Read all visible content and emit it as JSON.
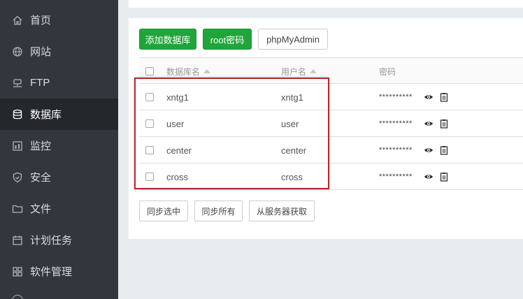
{
  "sidebar": {
    "items": [
      {
        "label": "首页",
        "icon": "home-icon"
      },
      {
        "label": "网站",
        "icon": "globe-icon"
      },
      {
        "label": "FTP",
        "icon": "ftp-icon"
      },
      {
        "label": "数据库",
        "icon": "database-icon",
        "active": true
      },
      {
        "label": "监控",
        "icon": "monitor-icon"
      },
      {
        "label": "安全",
        "icon": "shield-icon"
      },
      {
        "label": "文件",
        "icon": "folder-icon"
      },
      {
        "label": "计划任务",
        "icon": "calendar-icon"
      },
      {
        "label": "软件管理",
        "icon": "apps-icon"
      }
    ]
  },
  "toolbar": {
    "add_db_label": "添加数据库",
    "root_pwd_label": "root密码",
    "phpmyadmin_label": "phpMyAdmin"
  },
  "table": {
    "headers": {
      "db_name": "数据库名",
      "user_name": "用户名",
      "password": "密码"
    },
    "rows": [
      {
        "db": "xntg1",
        "user": "xntg1",
        "password": "**********"
      },
      {
        "db": "user",
        "user": "user",
        "password": "**********"
      },
      {
        "db": "center",
        "user": "center",
        "password": "**********"
      },
      {
        "db": "cross",
        "user": "cross",
        "password": "**********"
      }
    ]
  },
  "footer": {
    "sync_selected_label": "同步选中",
    "sync_all_label": "同步所有",
    "fetch_from_server_label": "从服务器获取"
  },
  "colors": {
    "sidebar_bg": "#32373d",
    "sidebar_active_bg": "#24282c",
    "accent_green": "#20a53a",
    "highlight_red": "#b22a2a"
  }
}
